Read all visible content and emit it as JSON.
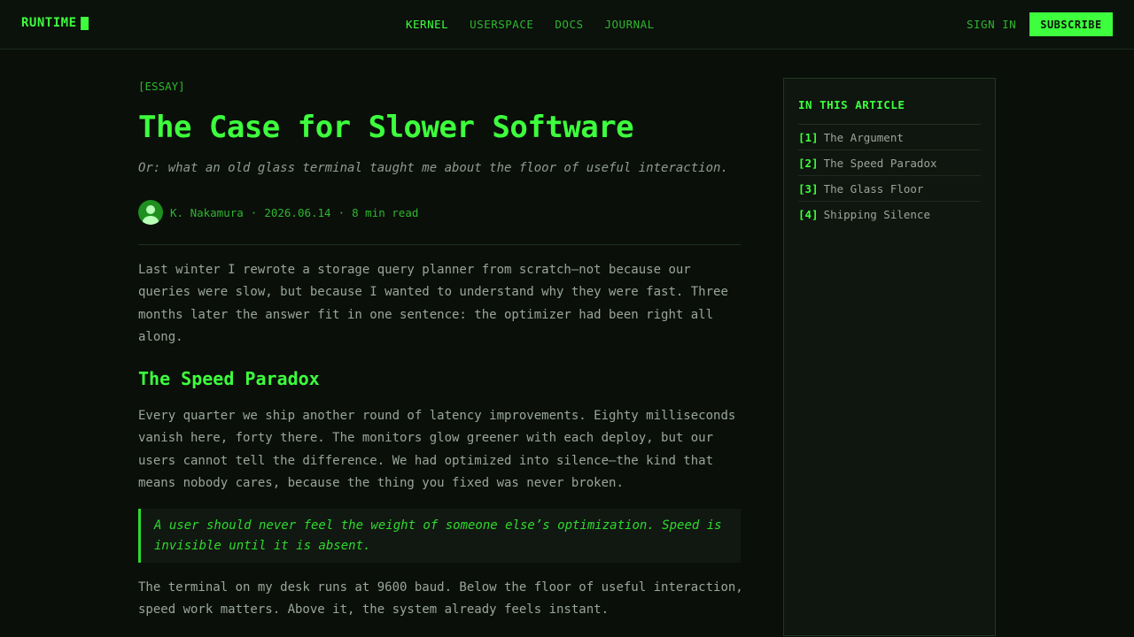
{
  "header": {
    "logo": "RUNTIME",
    "nav": [
      {
        "label": "KERNEL"
      },
      {
        "label": "USERSPACE"
      },
      {
        "label": "DOCS"
      },
      {
        "label": "JOURNAL"
      }
    ],
    "sign_in": "SIGN IN",
    "subscribe": "SUBSCRIBE"
  },
  "article": {
    "tag": "[ESSAY]",
    "title": "The Case for Slower Software",
    "subtitle": "Or: what an old glass terminal taught me about the floor of useful interaction.",
    "author": "K. Nakamura",
    "date": "2026.06.14",
    "read_time": "8 min read",
    "separator": "·",
    "p1": "Last winter I rewrote a storage query planner from scratch—not because our queries were slow, but because I wanted to understand why they were fast. Three months later the answer fit in one sentence: the optimizer had been right all along.",
    "h2": "The Speed Paradox",
    "p2": "Every quarter we ship another round of latency improvements. Eighty milliseconds vanish here, forty there. The monitors glow greener with each deploy, but our users cannot tell the difference. We had optimized into silence—the kind that means nobody cares, because the thing you fixed was never broken.",
    "quote": "A user should never feel the weight of someone else’s optimization. Speed is invisible until it is absent.",
    "p3": "The terminal on my desk runs at 9600 baud. Below the floor of useful interaction, speed work matters. Above it, the system already feels instant."
  },
  "toc": {
    "title": "IN THIS ARTICLE",
    "items": [
      {
        "num": "[1]",
        "label": "The Argument"
      },
      {
        "num": "[2]",
        "label": "The Speed Paradox"
      },
      {
        "num": "[3]",
        "label": "The Glass Floor"
      },
      {
        "num": "[4]",
        "label": "Shipping Silence"
      }
    ]
  },
  "colors": {
    "accent": "#3dff3d",
    "background": "#0a0f0a",
    "text": "#9aa69a"
  }
}
